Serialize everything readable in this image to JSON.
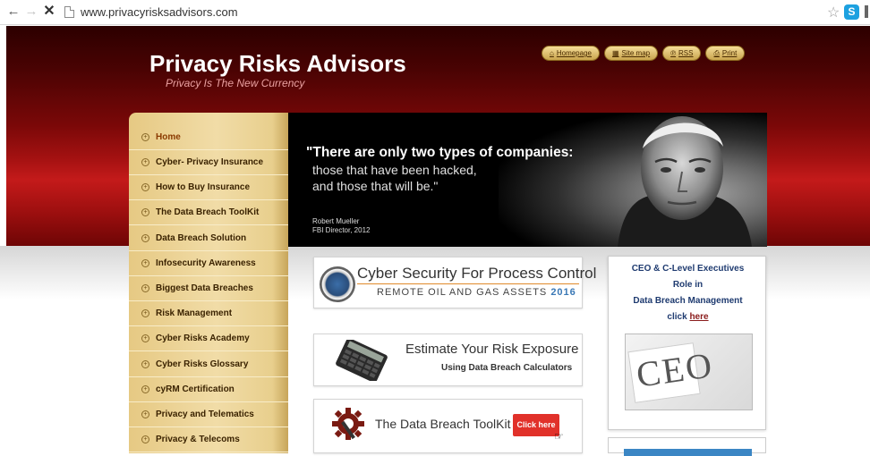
{
  "browser": {
    "url": "www.privacyrisksadvisors.com",
    "skype_label": "S"
  },
  "header": {
    "title": "Privacy Risks Advisors",
    "tagline": "Privacy Is The New Currency",
    "links": [
      {
        "label": "Homepage",
        "icon": "home-icon"
      },
      {
        "label": "Site map",
        "icon": "sitemap-icon"
      },
      {
        "label": "RSS",
        "icon": "rss-icon"
      },
      {
        "label": "Print",
        "icon": "print-icon"
      }
    ]
  },
  "nav": {
    "items": [
      {
        "label": "Home"
      },
      {
        "label": "Cyber- Privacy Insurance"
      },
      {
        "label": "How to Buy Insurance"
      },
      {
        "label": "The Data Breach ToolKit"
      },
      {
        "label": "Data Breach Solution"
      },
      {
        "label": "Infosecurity Awareness"
      },
      {
        "label": "Biggest Data Breaches"
      },
      {
        "label": "Risk Management"
      },
      {
        "label": "Cyber Risks Academy"
      },
      {
        "label": "Cyber Risks Glossary"
      },
      {
        "label": "cyRM Certification"
      },
      {
        "label": "Privacy and Telematics"
      },
      {
        "label": "Privacy & Telecoms"
      }
    ]
  },
  "banner": {
    "quote_line1": "\"There are only two types of companies:",
    "quote_line2": "those that have been hacked,",
    "quote_line3": "and those that will be.\"",
    "author": "Robert Mueller",
    "author_title": "FBI Director, 2012"
  },
  "cards": {
    "process_control_title": "Cyber Security For Process Control",
    "process_control_sub": "REMOTE OIL AND GAS ASSETS",
    "process_control_year": "2016",
    "risk_title": "Estimate Your Risk Exposure",
    "risk_sub": "Using Data Breach Calculators",
    "toolkit_title": "The Data Breach ToolKit",
    "toolkit_button": "Click here"
  },
  "sidebar": {
    "line1": "CEO & C-Level Executives",
    "line2": "Role in",
    "line3": "Data Breach Management",
    "click_prefix": "click ",
    "click_link": "here",
    "image_text": "CEO"
  }
}
